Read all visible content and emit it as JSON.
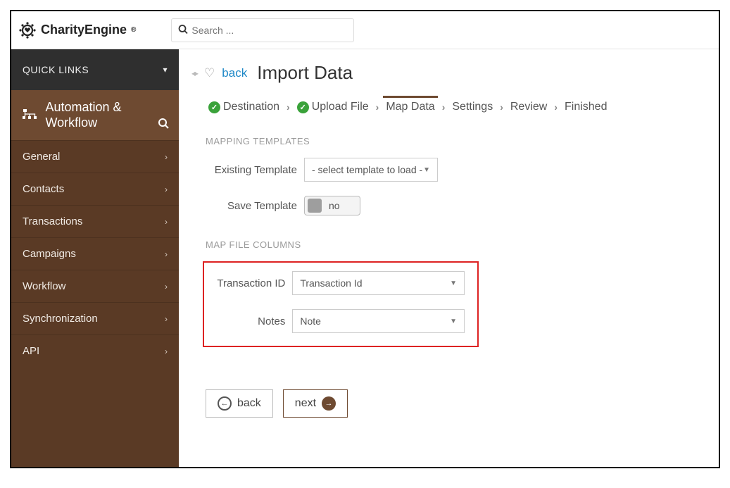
{
  "header": {
    "brand": "CharityEngine",
    "search_placeholder": "Search ..."
  },
  "sidebar": {
    "quick_links_label": "QUICK LINKS",
    "section_title": "Automation & Workflow",
    "items": [
      {
        "label": "General"
      },
      {
        "label": "Contacts"
      },
      {
        "label": "Transactions"
      },
      {
        "label": "Campaigns"
      },
      {
        "label": "Workflow"
      },
      {
        "label": "Synchronization"
      },
      {
        "label": "API"
      }
    ]
  },
  "page": {
    "back_label": "back",
    "title": "Import Data"
  },
  "stepper": {
    "steps": [
      {
        "label": "Destination",
        "done": true
      },
      {
        "label": "Upload File",
        "done": true
      },
      {
        "label": "Map Data",
        "done": false,
        "current": true
      },
      {
        "label": "Settings",
        "done": false
      },
      {
        "label": "Review",
        "done": false
      },
      {
        "label": "Finished",
        "done": false
      }
    ]
  },
  "sections": {
    "templates_label": "MAPPING TEMPLATES",
    "columns_label": "MAP FILE COLUMNS"
  },
  "mapping_templates": {
    "existing_label": "Existing Template",
    "existing_value": "- select template to load -",
    "save_label": "Save Template",
    "save_value": "no"
  },
  "map_columns": {
    "rows": [
      {
        "label": "Transaction ID",
        "value": "Transaction Id"
      },
      {
        "label": "Notes",
        "value": "Note"
      }
    ]
  },
  "buttons": {
    "back": "back",
    "next": "next"
  }
}
